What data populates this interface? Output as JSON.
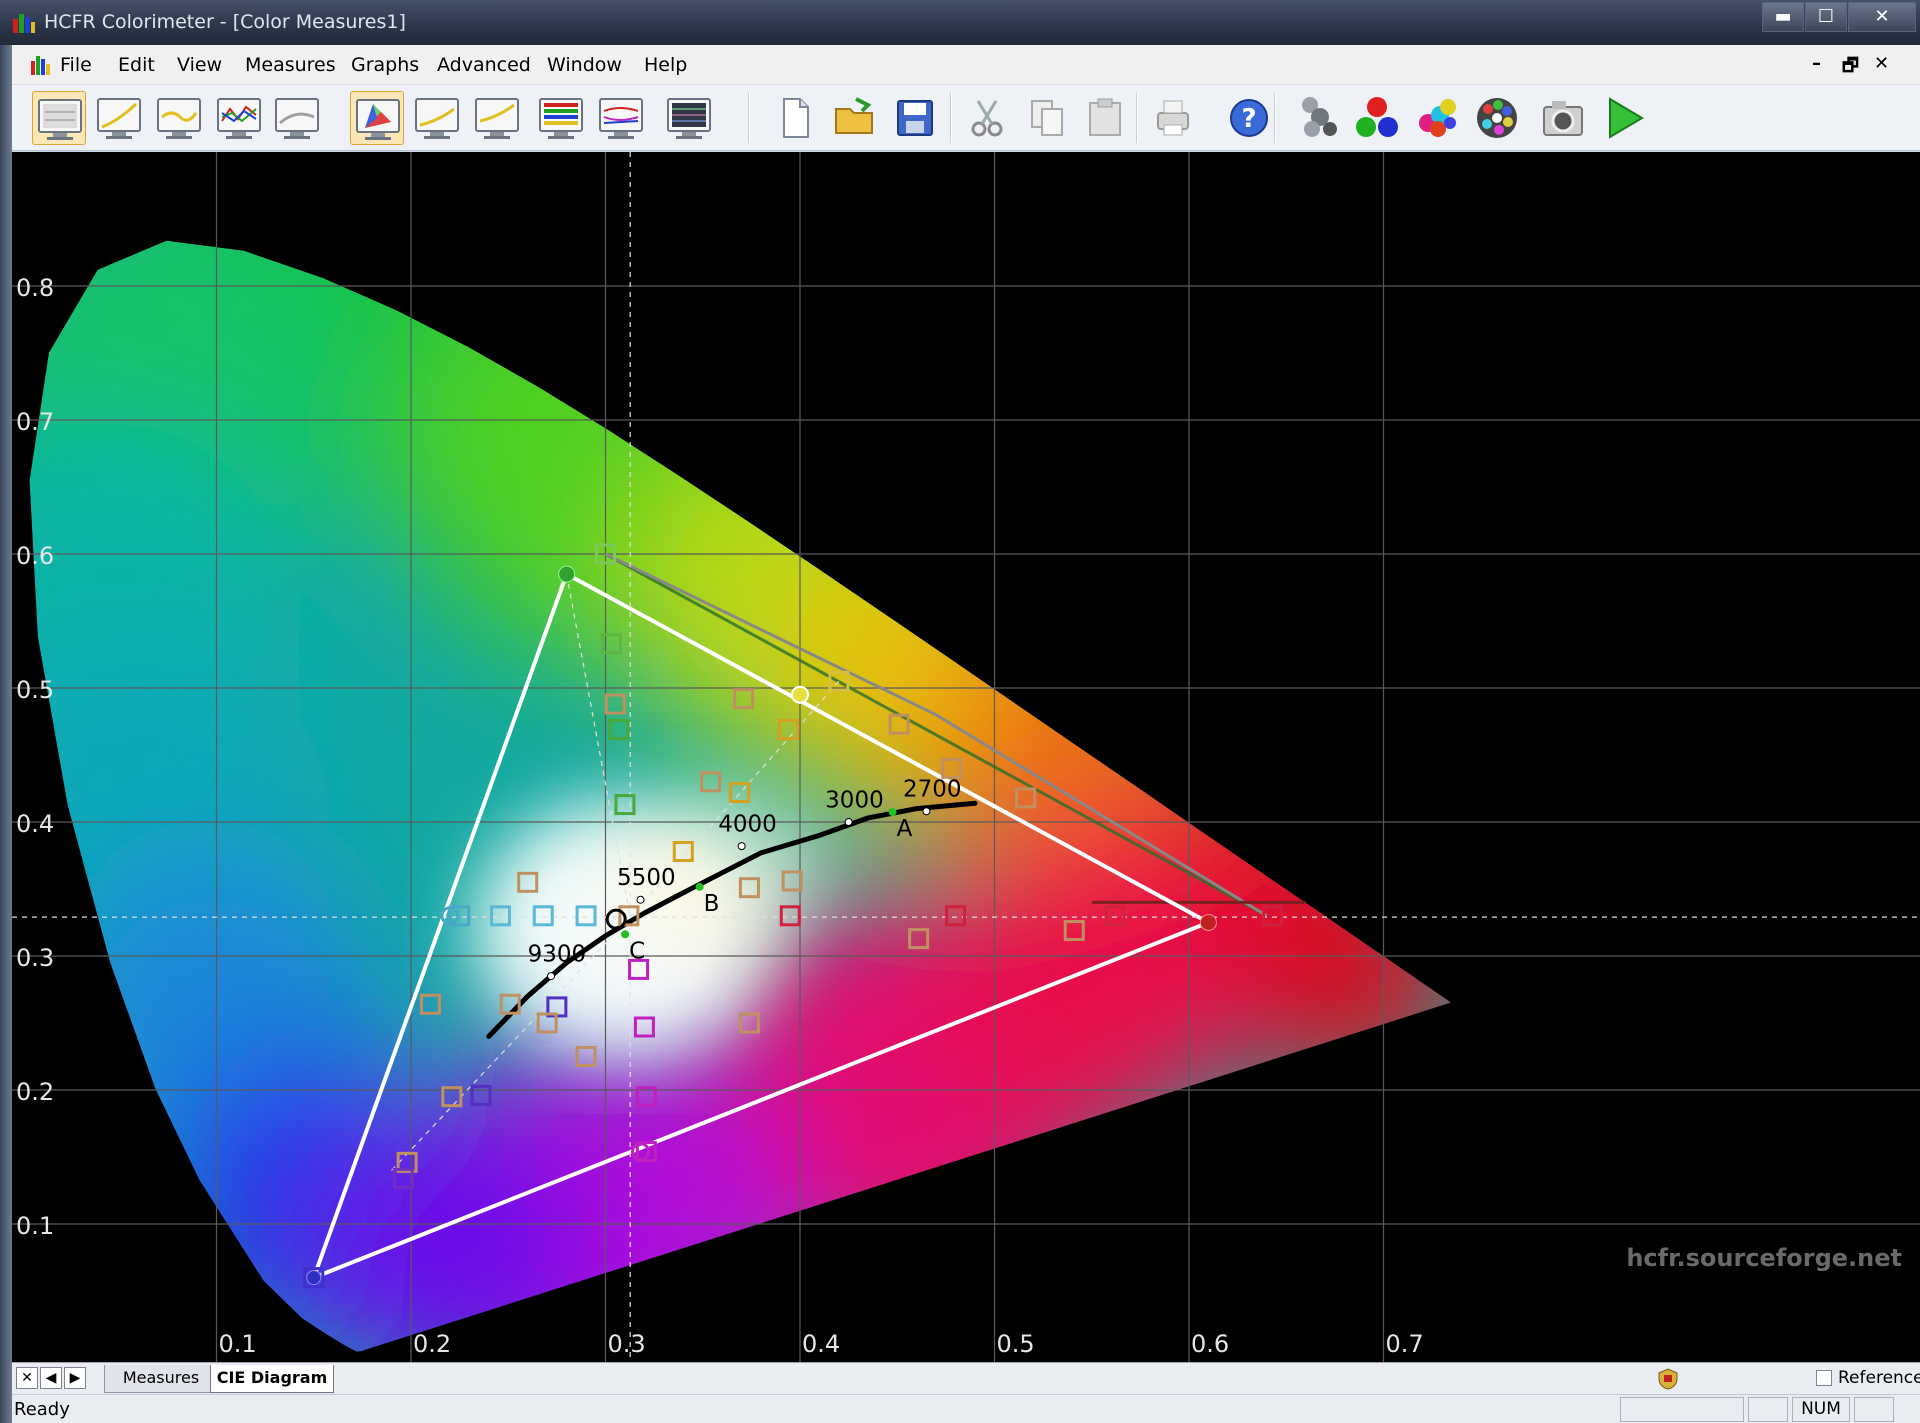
{
  "window": {
    "title": "HCFR Colorimeter - [Color Measures1]",
    "min": "▬",
    "max": "☐",
    "close": "✕"
  },
  "menu": {
    "items": [
      "File",
      "Edit",
      "View",
      "Measures",
      "Graphs",
      "Advanced",
      "Window",
      "Help"
    ],
    "mdi_min": "–",
    "mdi_restore": "🗗",
    "mdi_close": "✕"
  },
  "toolbar": {
    "views": [
      "monitor-summary-icon",
      "gamma-curve-icon",
      "luminance-curve-icon",
      "rgb-levels-icon",
      "color-temp-icon",
      "cie-diagram-icon",
      "near-black-icon",
      "near-white-icon",
      "saturation-icon",
      "saturation-shift-icon",
      "measures-grid-icon"
    ],
    "files": [
      "new-document-icon",
      "open-folder-icon",
      "save-icon",
      "cut-icon",
      "copy-icon",
      "paste-icon",
      "print-icon",
      "help-icon"
    ],
    "measure": [
      "sensor-icon",
      "primaries-icon",
      "secondaries-icon",
      "color-checker-icon",
      "camera-icon",
      "play-icon"
    ],
    "selected": [
      0,
      5
    ]
  },
  "chart_data": {
    "type": "scatter",
    "title": "",
    "xlim": [
      0.0,
      0.8
    ],
    "ylim": [
      0.0,
      0.9
    ],
    "x_ticks": [
      "0.1",
      "0.2",
      "0.3",
      "0.4",
      "0.5",
      "0.6",
      "0.7"
    ],
    "y_ticks": [
      "0.1",
      "0.2",
      "0.3",
      "0.4",
      "0.5",
      "0.6",
      "0.7",
      "0.8"
    ],
    "grid": true,
    "spectral_locus": [
      [
        0.1741,
        0.005
      ],
      [
        0.172,
        0.0048
      ],
      [
        0.1666,
        0.0089
      ],
      [
        0.1566,
        0.0177
      ],
      [
        0.144,
        0.0297
      ],
      [
        0.1241,
        0.0578
      ],
      [
        0.0913,
        0.1327
      ],
      [
        0.0687,
        0.2007
      ],
      [
        0.0454,
        0.295
      ],
      [
        0.0235,
        0.4127
      ],
      [
        0.0082,
        0.5384
      ],
      [
        0.0039,
        0.6548
      ],
      [
        0.0139,
        0.7502
      ],
      [
        0.0389,
        0.812
      ],
      [
        0.0743,
        0.8338
      ],
      [
        0.1142,
        0.8262
      ],
      [
        0.1547,
        0.8059
      ],
      [
        0.1929,
        0.7816
      ],
      [
        0.2296,
        0.7543
      ],
      [
        0.2658,
        0.7243
      ],
      [
        0.3016,
        0.6923
      ],
      [
        0.3373,
        0.6589
      ],
      [
        0.3731,
        0.6245
      ],
      [
        0.4087,
        0.5896
      ],
      [
        0.4441,
        0.5547
      ],
      [
        0.4788,
        0.5202
      ],
      [
        0.5125,
        0.4866
      ],
      [
        0.5448,
        0.4544
      ],
      [
        0.5752,
        0.4242
      ],
      [
        0.6029,
        0.3965
      ],
      [
        0.627,
        0.3725
      ],
      [
        0.6482,
        0.3514
      ],
      [
        0.6658,
        0.334
      ],
      [
        0.6801,
        0.3197
      ],
      [
        0.6915,
        0.3083
      ],
      [
        0.7006,
        0.2993
      ],
      [
        0.7347,
        0.2653
      ]
    ],
    "gamut_measured": {
      "red": [
        0.61,
        0.325
      ],
      "green": [
        0.28,
        0.585
      ],
      "blue": [
        0.15,
        0.06
      ]
    },
    "gamut_reference": {
      "red": [
        0.64,
        0.33
      ],
      "green": [
        0.3,
        0.6
      ],
      "blue": [
        0.15,
        0.06
      ]
    },
    "gamut_wide_edge": [
      [
        0.3,
        0.6
      ],
      [
        0.64,
        0.33
      ]
    ],
    "white_point": [
      0.3127,
      0.329
    ],
    "planckian_locus": [
      [
        0.24,
        0.24
      ],
      [
        0.26,
        0.27
      ],
      [
        0.28,
        0.295
      ],
      [
        0.3,
        0.315
      ],
      [
        0.32,
        0.332
      ],
      [
        0.345,
        0.351
      ],
      [
        0.38,
        0.377
      ],
      [
        0.41,
        0.39
      ],
      [
        0.435,
        0.403
      ],
      [
        0.46,
        0.41
      ],
      [
        0.49,
        0.414
      ]
    ],
    "locus_labels": [
      {
        "text": "9300",
        "x": 0.262,
        "y": 0.29
      },
      {
        "text": "5500",
        "x": 0.308,
        "y": 0.347
      },
      {
        "text": "4000",
        "x": 0.36,
        "y": 0.387
      },
      {
        "text": "3000",
        "x": 0.415,
        "y": 0.405
      },
      {
        "text": "2700",
        "x": 0.455,
        "y": 0.413
      }
    ],
    "illuminants": [
      {
        "text": "A",
        "x": 0.4476,
        "y": 0.4074
      },
      {
        "text": "B",
        "x": 0.3484,
        "y": 0.3516
      },
      {
        "text": "C",
        "x": 0.3101,
        "y": 0.3162
      }
    ],
    "measurements": [
      {
        "x": 0.3,
        "y": 0.6,
        "color": "#7cc85a"
      },
      {
        "x": 0.303,
        "y": 0.533,
        "color": "#5bb540"
      },
      {
        "x": 0.305,
        "y": 0.488,
        "color": "#c09060"
      },
      {
        "x": 0.307,
        "y": 0.469,
        "color": "#4aa83a"
      },
      {
        "x": 0.31,
        "y": 0.413,
        "color": "#4aa83a"
      },
      {
        "x": 0.42,
        "y": 0.505,
        "color": "#d6c040"
      },
      {
        "x": 0.371,
        "y": 0.492,
        "color": "#c09060"
      },
      {
        "x": 0.394,
        "y": 0.469,
        "color": "#d6a020"
      },
      {
        "x": 0.354,
        "y": 0.43,
        "color": "#c09060"
      },
      {
        "x": 0.369,
        "y": 0.422,
        "color": "#d6a020"
      },
      {
        "x": 0.34,
        "y": 0.378,
        "color": "#d6a020"
      },
      {
        "x": 0.451,
        "y": 0.473,
        "color": "#c09060"
      },
      {
        "x": 0.478,
        "y": 0.44,
        "color": "#c09060"
      },
      {
        "x": 0.516,
        "y": 0.418,
        "color": "#c09060"
      },
      {
        "x": 0.26,
        "y": 0.355,
        "color": "#c09060"
      },
      {
        "x": 0.374,
        "y": 0.351,
        "color": "#c09060"
      },
      {
        "x": 0.396,
        "y": 0.356,
        "color": "#c09060"
      },
      {
        "x": 0.225,
        "y": 0.33,
        "color": "#4aa8c8"
      },
      {
        "x": 0.246,
        "y": 0.33,
        "color": "#5ab8d8"
      },
      {
        "x": 0.268,
        "y": 0.33,
        "color": "#5ab8d8"
      },
      {
        "x": 0.29,
        "y": 0.33,
        "color": "#5ab8d8"
      },
      {
        "x": 0.312,
        "y": 0.33,
        "color": "#c09060"
      },
      {
        "x": 0.395,
        "y": 0.33,
        "color": "#d02040"
      },
      {
        "x": 0.48,
        "y": 0.33,
        "color": "#d02040"
      },
      {
        "x": 0.562,
        "y": 0.33,
        "color": "#d02040"
      },
      {
        "x": 0.643,
        "y": 0.33,
        "color": "#d02040"
      },
      {
        "x": 0.461,
        "y": 0.313,
        "color": "#c09060"
      },
      {
        "x": 0.541,
        "y": 0.319,
        "color": "#c09060"
      },
      {
        "x": 0.21,
        "y": 0.264,
        "color": "#c09060"
      },
      {
        "x": 0.251,
        "y": 0.264,
        "color": "#c09060"
      },
      {
        "x": 0.275,
        "y": 0.262,
        "color": "#5030c0"
      },
      {
        "x": 0.27,
        "y": 0.25,
        "color": "#c09060"
      },
      {
        "x": 0.317,
        "y": 0.29,
        "color": "#c020c0"
      },
      {
        "x": 0.32,
        "y": 0.247,
        "color": "#c020c0"
      },
      {
        "x": 0.374,
        "y": 0.25,
        "color": "#c09060"
      },
      {
        "x": 0.29,
        "y": 0.225,
        "color": "#c09060"
      },
      {
        "x": 0.221,
        "y": 0.195,
        "color": "#c09060"
      },
      {
        "x": 0.236,
        "y": 0.196,
        "color": "#5030c0"
      },
      {
        "x": 0.321,
        "y": 0.195,
        "color": "#c020c0"
      },
      {
        "x": 0.198,
        "y": 0.146,
        "color": "#c09060"
      },
      {
        "x": 0.196,
        "y": 0.134,
        "color": "#7030c0"
      },
      {
        "x": 0.321,
        "y": 0.154,
        "color": "#c020c0"
      },
      {
        "x": 0.15,
        "y": 0.06,
        "color": "#4030d0"
      }
    ],
    "watermark": "hcfr.sourceforge.net"
  },
  "tabs": {
    "measures": "Measures",
    "cie": "CIE Diagram",
    "nav": [
      "✕",
      "◀",
      "▶"
    ]
  },
  "reference_label": "Reference",
  "status": {
    "text": "Ready",
    "num": "NUM"
  }
}
